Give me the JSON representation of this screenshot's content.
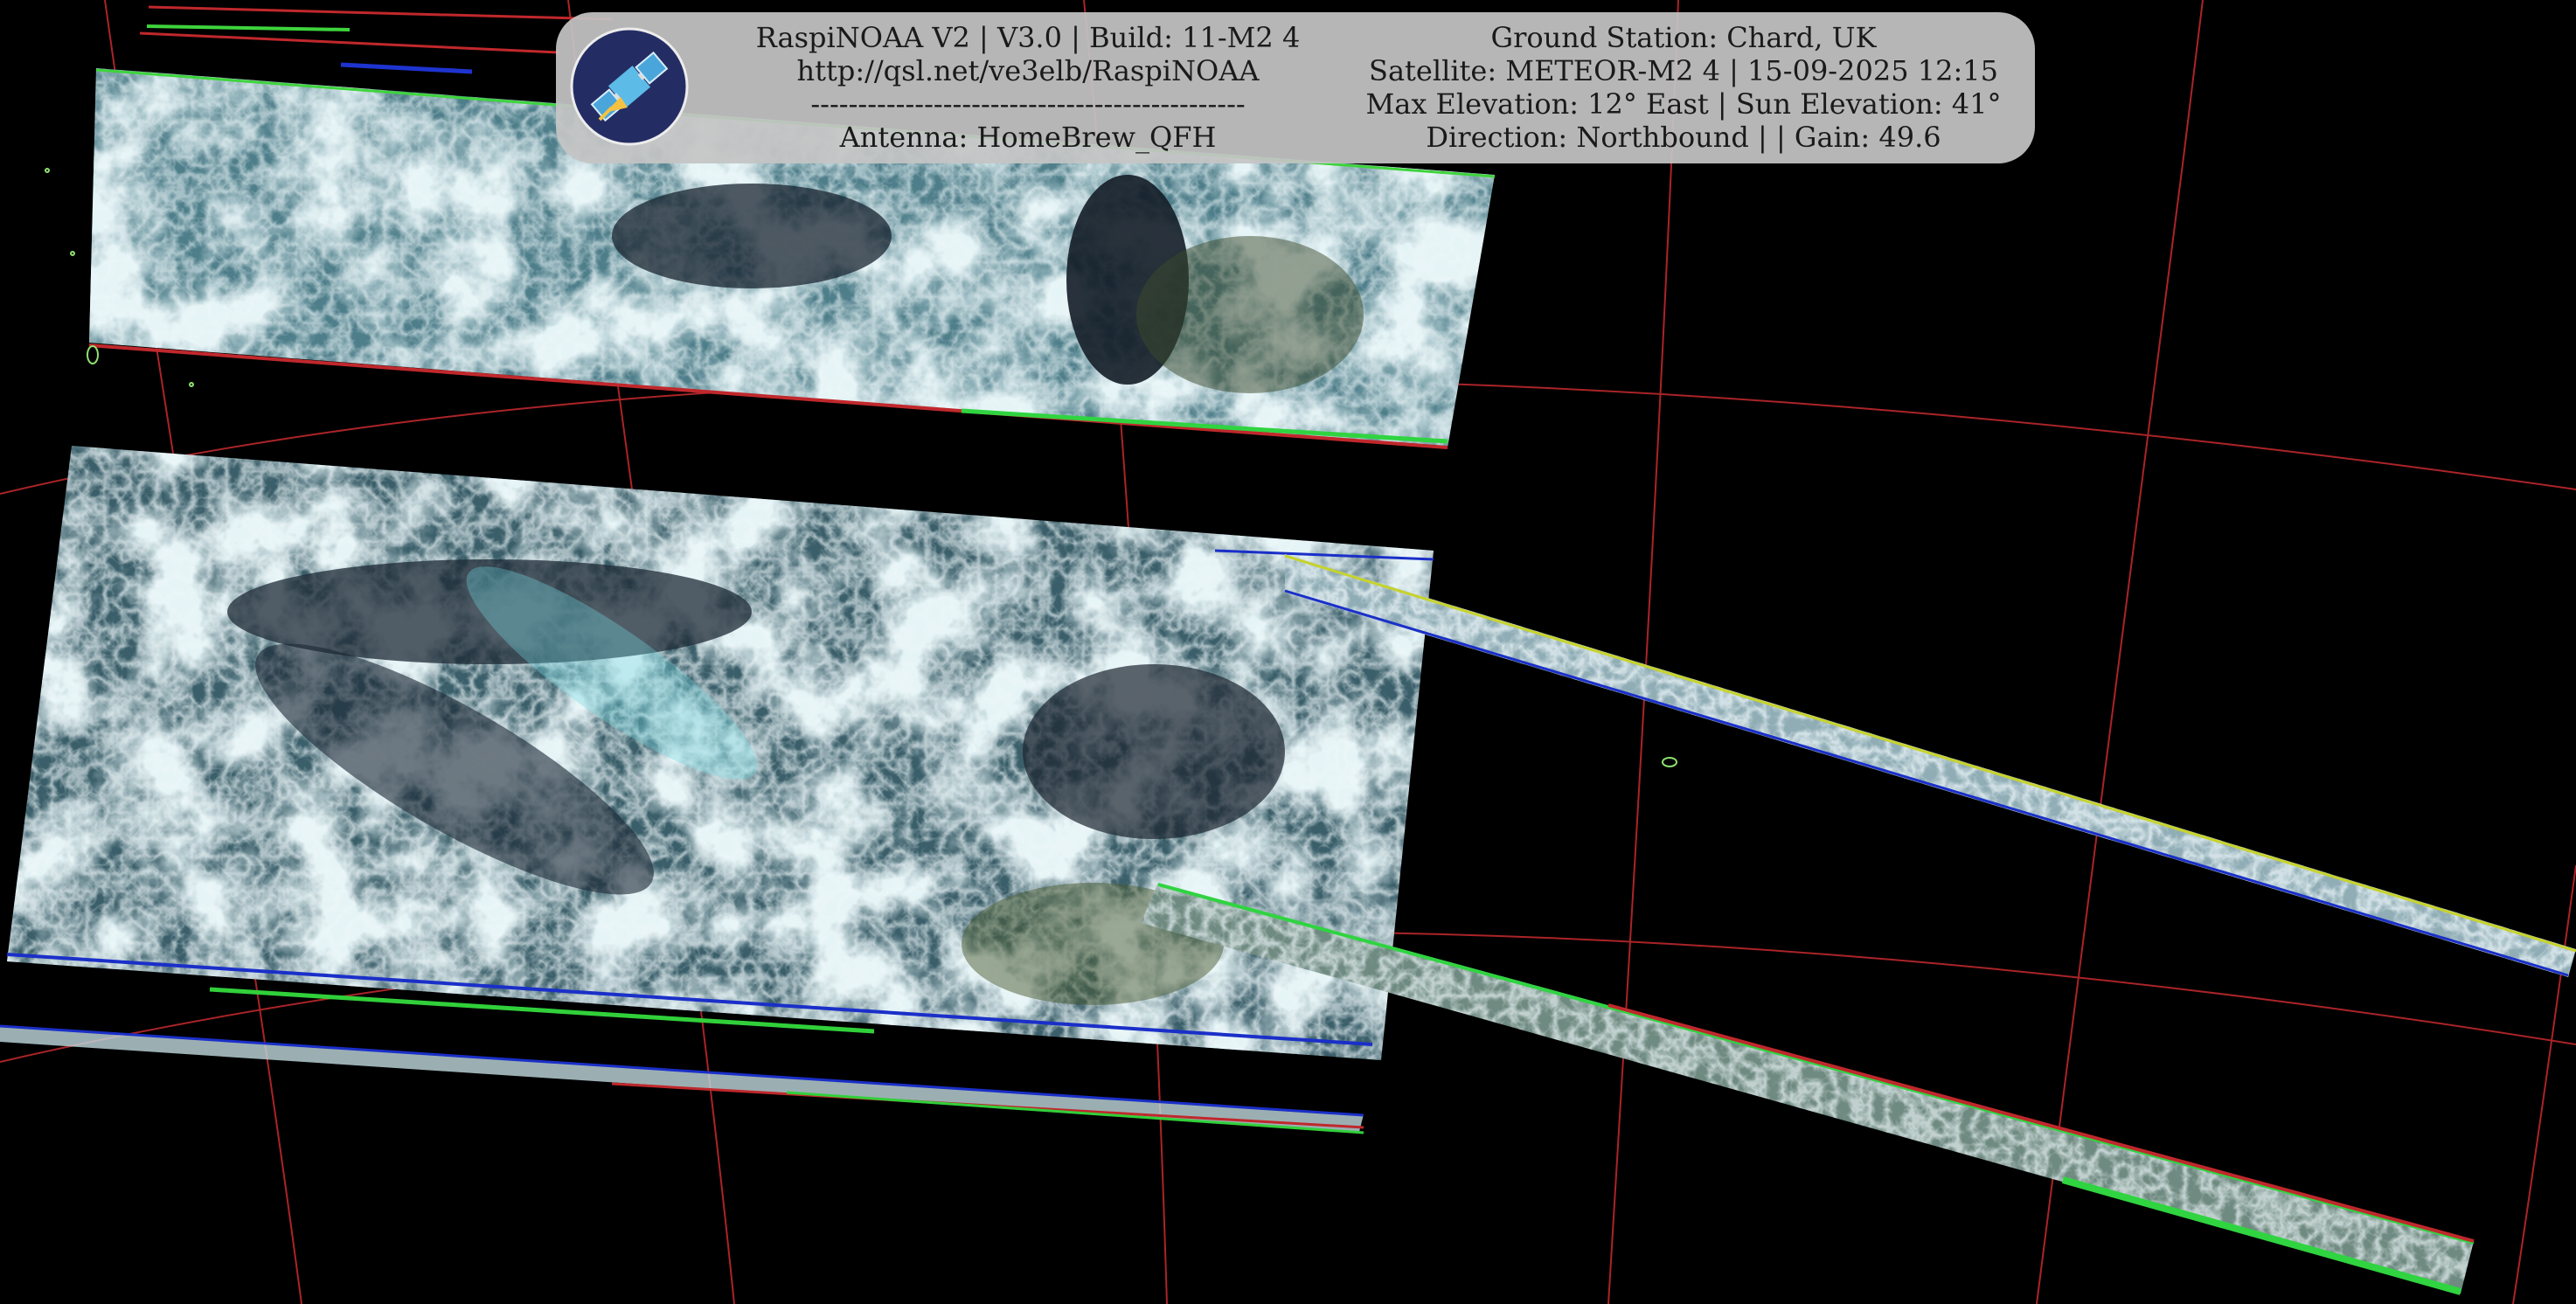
{
  "colors": {
    "space": "#000000",
    "grid": "#c0282c",
    "cloud": "#c7e6ea",
    "sea": "#1b2732",
    "cyan_haze": "#6fd6e0",
    "overlay_bg": "#c4c4c4",
    "logo_bg": "#242d63",
    "logo_sat": "#4aa6da"
  },
  "icons": {
    "logo": "satellite-icon"
  },
  "overlay": {
    "line1": "RaspiNOAA V2 | V3.0 | Build: 11-M2 4",
    "line2": "http://qsl.net/ve3elb/RaspiNOAA",
    "line3": "----------------------------------------------",
    "line4": "Antenna: HomeBrew_QFH",
    "line5": "Ground Station: Chard, UK",
    "line6": "Satellite: METEOR-M2 4 | 15-09-2025 12:15",
    "line7": "Max Elevation: 12° East | Sun Elevation: 41°",
    "line8": "Direction: Northbound | | Gain: 49.6"
  }
}
